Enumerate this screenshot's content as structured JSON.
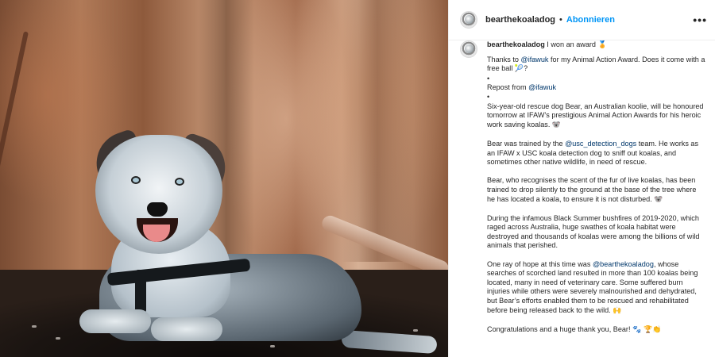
{
  "post": {
    "username": "bearthekoaladog",
    "follow_label": "Abonnieren",
    "separator": "•",
    "more_label": "•••"
  },
  "caption": {
    "username": "bearthekoaladog",
    "title_text": " I won an award ",
    "title_emoji": "🏅",
    "line1_a": "Thanks to ",
    "line1_tag": "@ifawuk",
    "line1_b": " for my Animal Action Award. Does it come with a free ball ",
    "line1_emoji": "🎾",
    "line1_c": "?",
    "bullet1": "•",
    "repost_a": "Repost from ",
    "repost_tag": "@ifawuk",
    "bullet2": "•",
    "para1": "Six-year-old rescue dog Bear, an Australian koolie, will be honoured tomorrow at IFAW’s prestigious Animal Action Awards for his heroic work saving koalas. ",
    "para1_emoji": "🐨",
    "para2_a": "Bear was trained by the ",
    "para2_tag": "@usc_detection_dogs",
    "para2_b": " team. He works as an IFAW x USC koala detection dog to sniff out koalas, and sometimes other native wildlife, in need of rescue.",
    "para3": "Bear, who recognises the scent of the fur of live koalas, has been trained to drop silently to the ground at the base of the tree where he has located a koala, to ensure it is not disturbed. ",
    "para3_emoji": "🐨",
    "para4": "During the infamous Black Summer bushfires of 2019-2020, which raged across Australia, huge swathes of koala habitat were destroyed and thousands of koalas were among the billions of wild animals that perished.",
    "para5_a": "One ray of hope at this time was ",
    "para5_tag": "@bearthekoaladog",
    "para5_b": ", whose searches of scorched land resulted in more than 100 koalas being located, many in need of veterinary care. Some suffered burn injuries while others were severely malnourished and dehydrated, but Bear’s efforts enabled them to be rescued and rehabilitated before being released back to the wild. ",
    "para5_emoji": "🙌",
    "para6": "Congratulations and a huge thank you, Bear! ",
    "para6_emoji": "🐾 🏆👏"
  }
}
